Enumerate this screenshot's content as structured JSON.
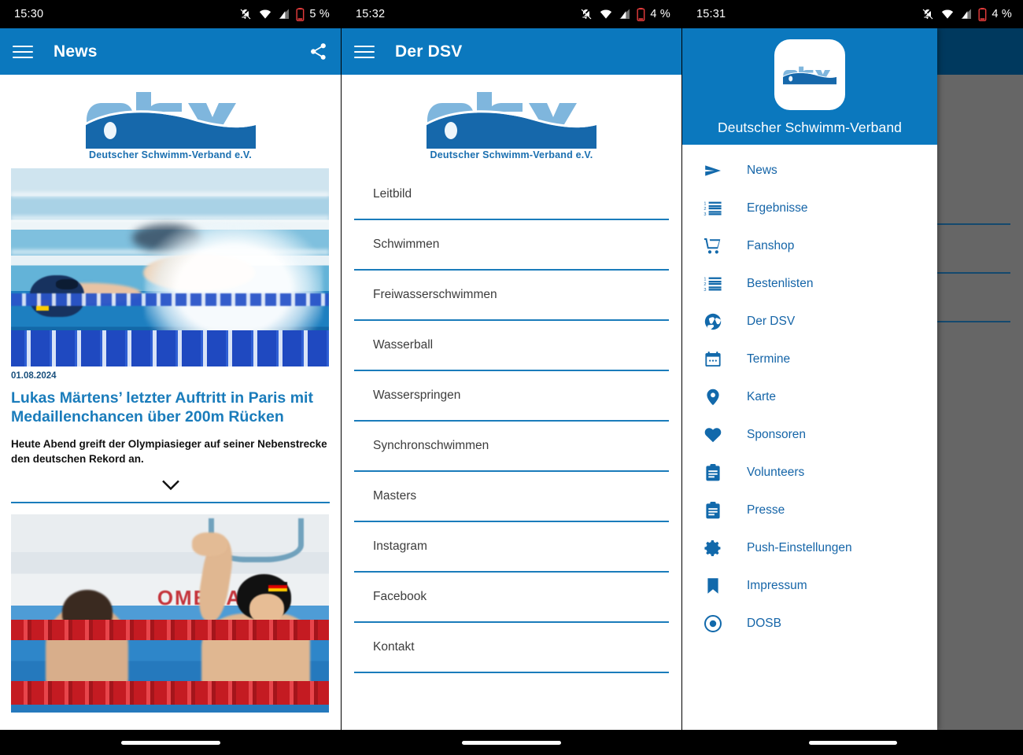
{
  "brand": {
    "primary": "#0b78be",
    "divider": "#1a7cbb",
    "drawer_text": "#1565a8",
    "logo_light": "#7fb6dd",
    "logo_dark": "#1668ab",
    "logo_caption": "Deutscher Schwimm-Verband e.V."
  },
  "screens": [
    {
      "status": {
        "time": "15:30",
        "battery": "5 %"
      },
      "appbar": {
        "title": "News",
        "menu_icon": "hamburger-icon",
        "action_icon": "share-icon"
      },
      "logo_caption": "Deutscher Schwimm-Verband e.V.",
      "articles": [
        {
          "date": "01.08.2024",
          "headline": "Lukas Märtens’ letzter Auftritt in Paris mit Medaillenchancen über 200m Rücken",
          "teaser": "Heute Abend greift der Olympiasieger auf seiner Nebenstrecke den deutschen Rekord an.",
          "expand_icon": "chevron-down-icon",
          "image_alt": "Backstroke swimmer in pool with splash"
        },
        {
          "image_alt": "Two swimmers celebrating in pool with OMEGA board"
        }
      ]
    },
    {
      "status": {
        "time": "15:32",
        "battery": "4 %"
      },
      "appbar": {
        "title": "Der DSV",
        "menu_icon": "hamburger-icon"
      },
      "logo_caption": "Deutscher Schwimm-Verband e.V.",
      "list_items": [
        "Leitbild",
        "Schwimmen",
        "Freiwasserschwimmen",
        "Wasserball",
        "Wasserspringen",
        "Synchronschwimmen",
        "Masters",
        "Instagram",
        "Facebook",
        "Kontakt"
      ]
    },
    {
      "status": {
        "time": "15:31",
        "battery": "4 %"
      },
      "drawer": {
        "app_name": "Deutscher Schwimm-Verband",
        "items": [
          {
            "label": "News",
            "icon": "send-icon"
          },
          {
            "label": "Ergebnisse",
            "icon": "numbered-list-icon"
          },
          {
            "label": "Fanshop",
            "icon": "shopping-cart-icon"
          },
          {
            "label": "Bestenlisten",
            "icon": "numbered-list-icon"
          },
          {
            "label": "Der DSV",
            "icon": "aperture-icon"
          },
          {
            "label": "Termine",
            "icon": "calendar-icon"
          },
          {
            "label": "Karte",
            "icon": "map-pin-icon"
          },
          {
            "label": "Sponsoren",
            "icon": "heart-icon"
          },
          {
            "label": "Volunteers",
            "icon": "clipboard-icon"
          },
          {
            "label": "Presse",
            "icon": "clipboard-icon"
          },
          {
            "label": "Push-Einstellungen",
            "icon": "gear-icon"
          },
          {
            "label": "Impressum",
            "icon": "bookmark-icon"
          },
          {
            "label": "DOSB",
            "icon": "radio-target-icon"
          }
        ]
      }
    }
  ]
}
